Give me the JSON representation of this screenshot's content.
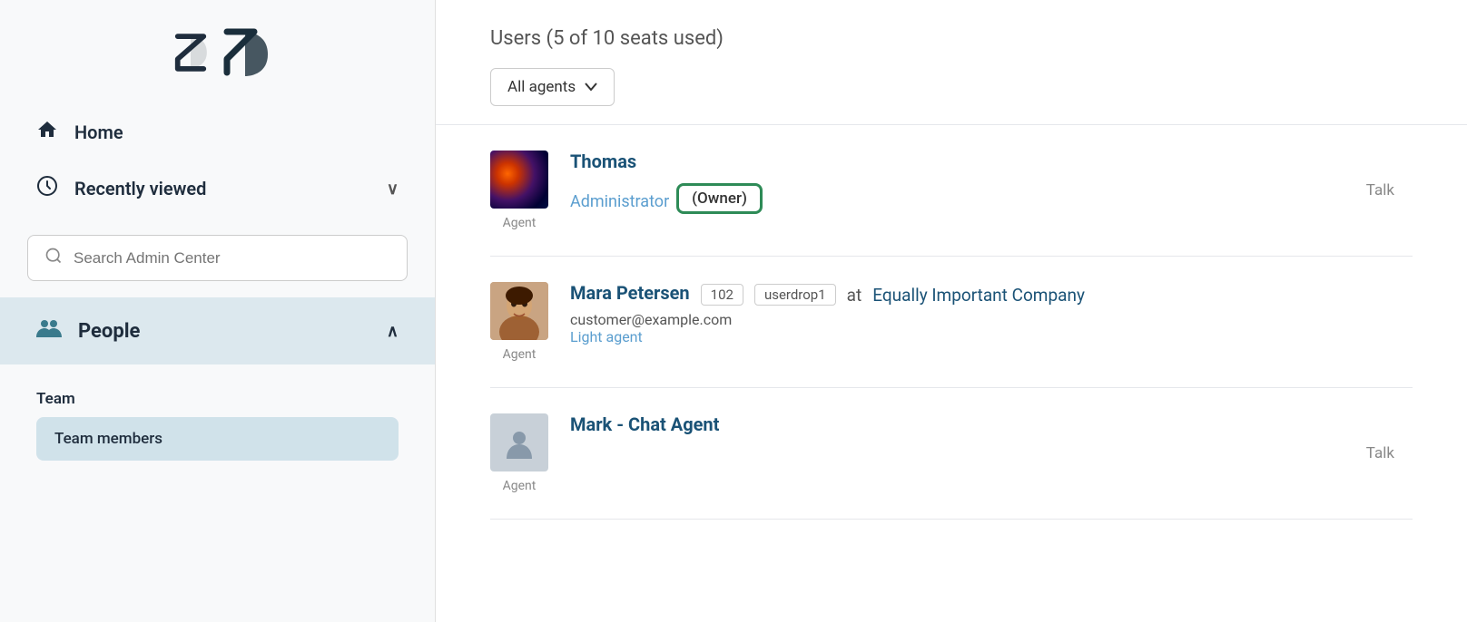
{
  "sidebar": {
    "logo_alt": "Zendesk logo",
    "nav": [
      {
        "id": "home",
        "label": "Home",
        "icon": "🏠"
      },
      {
        "id": "recently-viewed",
        "label": "Recently viewed",
        "icon": "🕐",
        "has_chevron": true,
        "chevron": "∨"
      }
    ],
    "search": {
      "placeholder": "Search Admin Center"
    },
    "people": {
      "label": "People",
      "icon": "👥",
      "chevron": "∧"
    },
    "team": {
      "label": "Team",
      "members_label": "Team members"
    }
  },
  "main": {
    "users_title": "Users (5 of 10 seats used)",
    "filter": {
      "label": "All agents",
      "chevron": "⌄"
    },
    "users": [
      {
        "id": "thomas",
        "name": "Thomas",
        "agent_label": "Agent",
        "role": "Administrator",
        "owner_badge": "(Owner)",
        "talk": "Talk",
        "has_owner": true
      },
      {
        "id": "mara",
        "name": "Mara Petersen",
        "agent_label": "Agent",
        "badge1": "102",
        "badge2": "userdrop1",
        "at_text": "at",
        "company": "Equally Important Company",
        "email": "customer@example.com",
        "role": "Light agent"
      },
      {
        "id": "mark",
        "name": "Mark - Chat Agent",
        "agent_label": "Agent",
        "talk": "Talk"
      }
    ]
  },
  "icons": {
    "home": "🏠",
    "clock": "🕐",
    "people": "👥",
    "search": "🔍",
    "chevron_down": "∨",
    "chevron_up": "∧"
  }
}
